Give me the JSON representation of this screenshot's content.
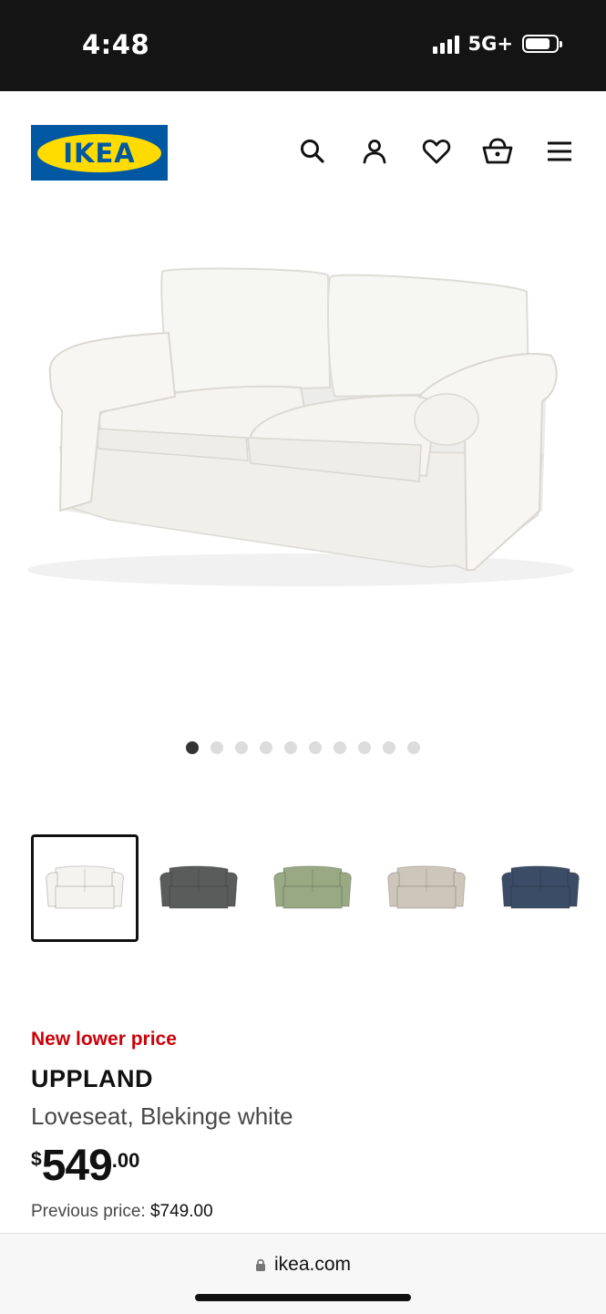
{
  "status": {
    "time": "4:48",
    "network": "5G+"
  },
  "brand": {
    "logo_text": "IKEA"
  },
  "header_icons": [
    "search-icon",
    "account-icon",
    "heart-icon",
    "cart-icon",
    "menu-icon"
  ],
  "gallery": {
    "image_count": 10,
    "active_index": 0
  },
  "color_options": [
    {
      "name": "white",
      "color": "#f4f3ef",
      "selected": true
    },
    {
      "name": "dark gray",
      "color": "#5a5c5c",
      "selected": false
    },
    {
      "name": "green",
      "color": "#98a983",
      "selected": false
    },
    {
      "name": "beige stripe",
      "color": "#cfc6bb",
      "selected": false
    },
    {
      "name": "blue",
      "color": "#3b4d66",
      "selected": false
    }
  ],
  "product": {
    "promo": "New lower price",
    "name": "UPPLAND",
    "description": "Loveseat, Blekinge white",
    "price_currency": "$",
    "price_main": "549",
    "price_decimal": ".00",
    "previous_label": "Previous price: ",
    "previous_price": "$749.00"
  },
  "browser": {
    "url": "ikea.com"
  },
  "colors": {
    "brand_blue": "#0058a3",
    "brand_yellow": "#ffdb00",
    "promo_red": "#cc0008"
  }
}
